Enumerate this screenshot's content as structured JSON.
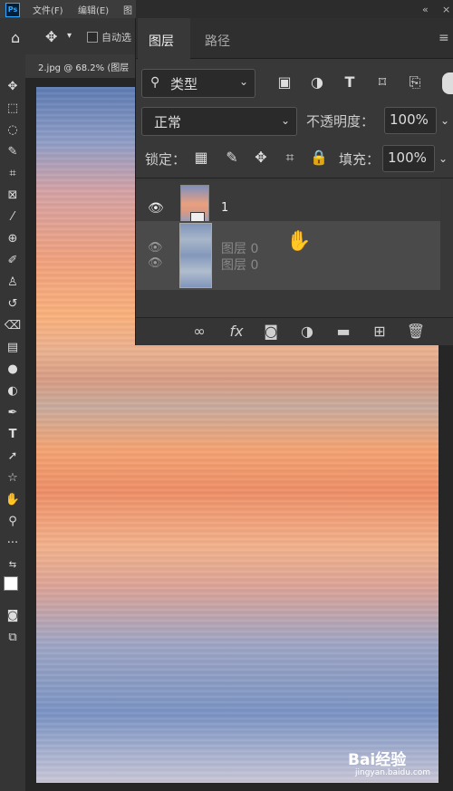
{
  "menubar": {
    "logo": "Ps",
    "items": [
      "文件(F)",
      "编辑(E)",
      "图"
    ]
  },
  "options_bar": {
    "home_icon": "home-icon",
    "move_icon": "move-icon",
    "caret": "▾",
    "auto_select_label": "自动选"
  },
  "document_tab": {
    "label": "2.jpg @ 68.2% (图层"
  },
  "layers_panel": {
    "collapse_glyph": "«",
    "close_glyph": "×",
    "menu_glyph": "≡",
    "tabs": [
      "图层",
      "路径"
    ],
    "active_tab": "图层",
    "filter": {
      "search_glyph": "⚲",
      "label": "类型",
      "caret": "⌄",
      "icons": [
        "image-filter-icon",
        "adjustment-filter-icon",
        "type-filter-icon",
        "shape-filter-icon",
        "smart-object-filter-icon"
      ]
    },
    "blend_mode": "正常",
    "blend_caret": "⌄",
    "opacity_label": "不透明度：",
    "opacity_value": "100%",
    "opacity_caret": "⌄",
    "lock_label": "锁定：",
    "lock_icons": [
      "lock-transparent-icon",
      "lock-image-icon",
      "lock-position-icon",
      "lock-artboard-icon",
      "lock-all-icon"
    ],
    "fill_label": "填充：",
    "fill_value": "100%",
    "fill_caret": "⌄",
    "layers": [
      {
        "name": "1",
        "visible": true
      },
      {
        "name": "图层 0",
        "visible": true,
        "dragging": true
      },
      {
        "name": "图层 0",
        "visible": true,
        "dragging": true
      }
    ],
    "footer_icons": [
      "link-icon",
      "fx-icon",
      "mask-icon",
      "adjustment-layer-icon",
      "group-folder-icon",
      "new-layer-icon",
      "trash-icon"
    ]
  },
  "toolbar": {
    "tools": [
      "move-tool",
      "marquee-tool",
      "lasso-tool",
      "quick-select-tool",
      "crop-tool",
      "frame-tool",
      "eyedropper-tool",
      "healing-tool",
      "brush-tool",
      "stamp-tool",
      "history-brush-tool",
      "eraser-tool",
      "gradient-tool",
      "blur-tool",
      "dodge-tool",
      "pen-tool",
      "type-tool",
      "path-select-tool",
      "shape-tool",
      "hand-tool",
      "zoom-tool",
      "more-tools",
      "swap-colors",
      "foreground-color",
      "quick-mask",
      "screen-mode"
    ]
  },
  "watermark": {
    "logo": "Bai经验",
    "sub": "经验",
    "url": "jingyan.baidu.com"
  },
  "colors": {
    "panel": "#383838",
    "toolbar": "#353535",
    "foreground": "#ffffff",
    "background": "#000000"
  }
}
